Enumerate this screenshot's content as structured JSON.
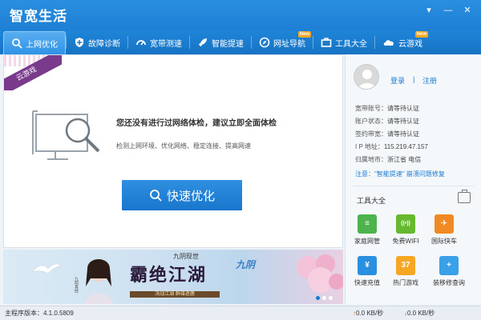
{
  "app": {
    "title": "智宽生活"
  },
  "window": {
    "menu_glyph": "▾",
    "min_glyph": "—",
    "close_glyph": "✕"
  },
  "nav": [
    {
      "label": "上网优化",
      "icon": "search-icon",
      "badge": ""
    },
    {
      "label": "故障诊断",
      "icon": "shield-plus-icon",
      "badge": ""
    },
    {
      "label": "宽带测速",
      "icon": "speedometer-icon",
      "badge": ""
    },
    {
      "label": "智能提速",
      "icon": "rocket-icon",
      "badge": ""
    },
    {
      "label": "网址导航",
      "icon": "compass-icon",
      "badge": "New"
    },
    {
      "label": "工具大全",
      "icon": "toolbox-icon",
      "badge": ""
    },
    {
      "label": "云游戏",
      "icon": "cloud-game-icon",
      "badge": "New"
    }
  ],
  "main": {
    "ribbon": "云游戏",
    "check_title": "您还没有进行过网络体检，建议立即全面体检",
    "check_sub": "检测上网环境、优化网络、稳定连接、提高网速",
    "optimize_label": "快速优化"
  },
  "banner": {
    "top_text": "九阴现世",
    "title": "霸绝江湖",
    "logo": "九阴",
    "strip": "决战江湖 群雄逐鹿",
    "side_text": "九阴真经"
  },
  "side": {
    "login": "登录",
    "separator": "|",
    "register": "注册",
    "info": [
      {
        "k": "宽带账号：",
        "v": "请等待认证"
      },
      {
        "k": "账户状态：",
        "v": "请等待认证"
      },
      {
        "k": "签约带宽：",
        "v": "请等待认证"
      },
      {
        "k": "I P 地址：",
        "v": "115.219.47.157"
      },
      {
        "k": "归属地市：",
        "v": "浙江省 电信"
      }
    ],
    "notice": "注意：\"智能提速\" 崩溃问题修复",
    "tools_label": "工具大全",
    "tools": [
      {
        "label": "家庭网管",
        "icon": "router-icon",
        "color": "#4db34d",
        "glyph": "≡"
      },
      {
        "label": "免费WIFI",
        "icon": "wifi-icon",
        "color": "#66b82e",
        "glyph": "((•))"
      },
      {
        "label": "国际快车",
        "icon": "globe-rocket-icon",
        "color": "#f08a24",
        "glyph": "✈"
      },
      {
        "label": "快速充值",
        "icon": "yen-icon",
        "color": "#2b8fe0",
        "glyph": "¥"
      },
      {
        "label": "热门游戏",
        "icon": "game-37-icon",
        "color": "#f5a623",
        "glyph": "37"
      },
      {
        "label": "装移修查询",
        "icon": "repair-icon",
        "color": "#3aa0e8",
        "glyph": "+"
      }
    ]
  },
  "status": {
    "version_label": "主程序版本：",
    "version": "4.1.0.5809",
    "up_speed": "0.0 KB/秒",
    "down_speed": "0.0 KB/秒"
  },
  "colors": {
    "brand": "#1e7fd4",
    "accent": "#1a7bd0",
    "ribbon": "#7a3a8c"
  }
}
